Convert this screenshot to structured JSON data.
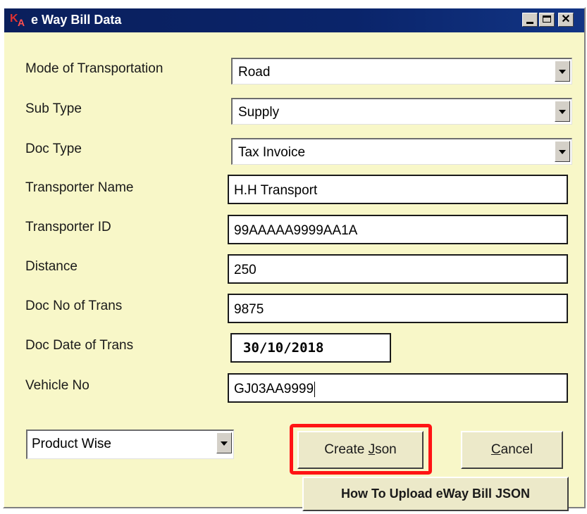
{
  "window": {
    "title": "e Way Bill Data",
    "icon": "ka-app-logo",
    "logo_text": "KA"
  },
  "form": {
    "mode_of_transportation": {
      "label": "Mode of Transportation",
      "value": "Road"
    },
    "sub_type": {
      "label": "Sub Type",
      "value": "Supply"
    },
    "doc_type": {
      "label": "Doc Type",
      "value": "Tax Invoice"
    },
    "transporter_name": {
      "label": "Transporter Name",
      "value": "H.H Transport"
    },
    "transporter_id": {
      "label": "Transporter ID",
      "value": "99AAAAA9999AA1A"
    },
    "distance": {
      "label": "Distance",
      "value": "250"
    },
    "doc_no_of_trans": {
      "label": "Doc No of Trans",
      "value": "9875"
    },
    "doc_date_of_trans": {
      "label": "Doc Date of Trans",
      "value": "30/10/2018"
    },
    "vehicle_no": {
      "label": "Vehicle No",
      "value": "GJ03AA9999"
    }
  },
  "footer": {
    "product_wise": "Product Wise",
    "create_json_prefix": "Create ",
    "create_json_mnemonic": "J",
    "create_json_suffix": "son",
    "cancel_mnemonic": "C",
    "cancel_suffix": "ancel",
    "how_to_upload": "How To Upload eWay Bill JSON"
  },
  "colors": {
    "window_bg": "#f8f7c8",
    "titlebar": "#0a246a",
    "highlight": "#ff1414"
  }
}
